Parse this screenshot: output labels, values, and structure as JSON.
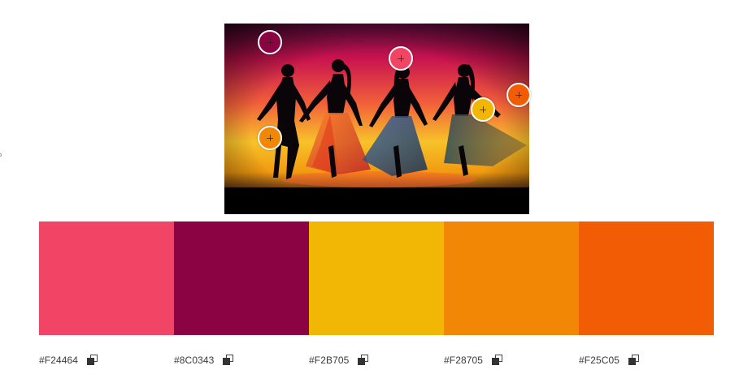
{
  "photo": {
    "icon": "silhouette-dancers-image"
  },
  "pickers": [
    {
      "color": "#8C0343"
    },
    {
      "color": "#F24464"
    },
    {
      "color": "#F25C05"
    },
    {
      "color": "#F2B705"
    },
    {
      "color": "#F28705"
    }
  ],
  "palette": [
    {
      "hex": "#F24464",
      "color": "#F24464",
      "copy_icon": "copy-icon"
    },
    {
      "hex": "#8C0343",
      "color": "#8C0343",
      "copy_icon": "copy-icon"
    },
    {
      "hex": "#F2B705",
      "color": "#F2B705",
      "copy_icon": "copy-icon"
    },
    {
      "hex": "#F28705",
      "color": "#F28705",
      "copy_icon": "copy-icon"
    },
    {
      "hex": "#F25C05",
      "color": "#F25C05",
      "copy_icon": "copy-icon"
    }
  ]
}
